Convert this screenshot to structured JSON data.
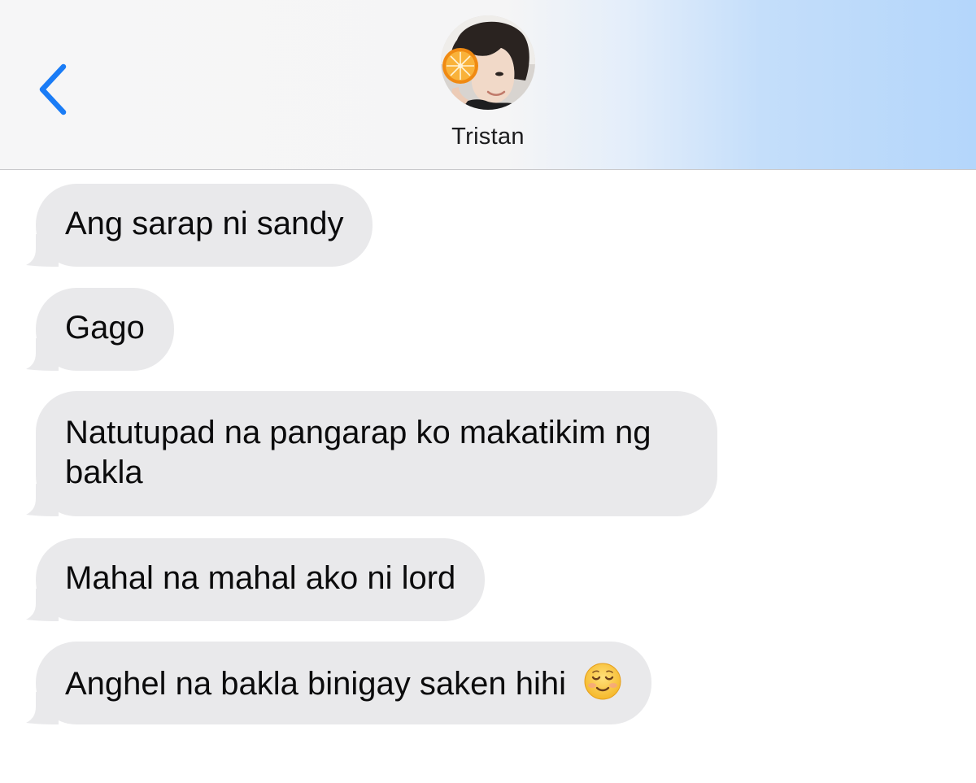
{
  "header": {
    "contact_name": "Tristan"
  },
  "colors": {
    "accent": "#1a7cf6",
    "bubble_incoming": "#e9e9eb",
    "header_gradient_end": "#b4d6fb"
  },
  "messages": [
    {
      "direction": "incoming",
      "text": "Ang sarap ni sandy"
    },
    {
      "direction": "incoming",
      "text": "Gago"
    },
    {
      "direction": "incoming",
      "text": "Natutupad na pangarap ko makatikim ng bakla"
    },
    {
      "direction": "incoming",
      "text": "Mahal na mahal ako ni lord"
    },
    {
      "direction": "incoming",
      "text": "Anghel na bakla binigay saken hihi",
      "emoji": "smiling-face-icon"
    }
  ],
  "icons": {
    "back": "chevron-left-icon",
    "avatar": "contact-avatar-photo"
  }
}
